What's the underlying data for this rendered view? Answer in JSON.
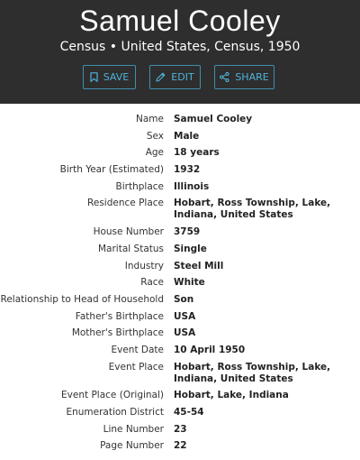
{
  "header": {
    "title": "Samuel Cooley",
    "subtitle": "Census • United States, Census, 1950",
    "accent_color": "#4eb3d8",
    "background_color": "#2e2e2e",
    "buttons": {
      "save": {
        "label": "SAVE",
        "icon": "bookmark-icon"
      },
      "edit": {
        "label": "EDIT",
        "icon": "pencil-icon"
      },
      "share": {
        "label": "SHARE",
        "icon": "share-icon"
      }
    }
  },
  "fields": [
    {
      "label": "Name",
      "value": "Samuel Cooley"
    },
    {
      "label": "Sex",
      "value": "Male"
    },
    {
      "label": "Age",
      "value": "18 years"
    },
    {
      "label": "Birth Year (Estimated)",
      "value": "1932"
    },
    {
      "label": "Birthplace",
      "value": "Illinois"
    },
    {
      "label": "Residence Place",
      "value": "Hobart, Ross Township, Lake, Indiana, United States"
    },
    {
      "label": "House Number",
      "value": "3759"
    },
    {
      "label": "Marital Status",
      "value": "Single"
    },
    {
      "label": "Industry",
      "value": "Steel Mill"
    },
    {
      "label": "Race",
      "value": "White"
    },
    {
      "label": "Relationship to Head of Household",
      "value": "Son"
    },
    {
      "label": "Father's Birthplace",
      "value": "USA"
    },
    {
      "label": "Mother's Birthplace",
      "value": "USA"
    },
    {
      "label": "Event Date",
      "value": "10 April 1950"
    },
    {
      "label": "Event Place",
      "value": "Hobart, Ross Township, Lake, Indiana, United States"
    },
    {
      "label": "Event Place (Original)",
      "value": "Hobart, Lake, Indiana"
    },
    {
      "label": "Enumeration District",
      "value": "45-54"
    },
    {
      "label": "Line Number",
      "value": "23"
    },
    {
      "label": "Page Number",
      "value": "22"
    }
  ]
}
